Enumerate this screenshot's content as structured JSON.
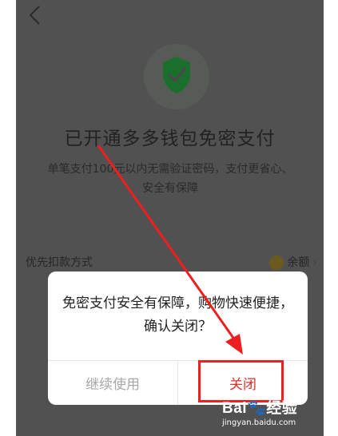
{
  "header": {
    "back_icon": "chevron-left-icon"
  },
  "hero": {
    "icon": "shield-check-icon",
    "title": "已开通多多钱包免密支付",
    "subtitle": "单笔支付100元以内无需验证密码，支付更省心、安全有保障"
  },
  "payment": {
    "label": "优先扣款方式",
    "method": "余额",
    "method_icon": "coin-icon"
  },
  "dialog": {
    "message": "免密支付安全有保障，购物快速便捷，确认关闭？",
    "continue_label": "继续使用",
    "close_label": "关闭"
  },
  "watermark": {
    "brand": "Bai",
    "brand_suffix": "经验",
    "url": "jingyan.baidu.com"
  },
  "colors": {
    "overlay": "#515151",
    "accent_red": "#e02e24",
    "annotation_red": "#ef1f1f",
    "shield_green": "#1b6f2c"
  }
}
